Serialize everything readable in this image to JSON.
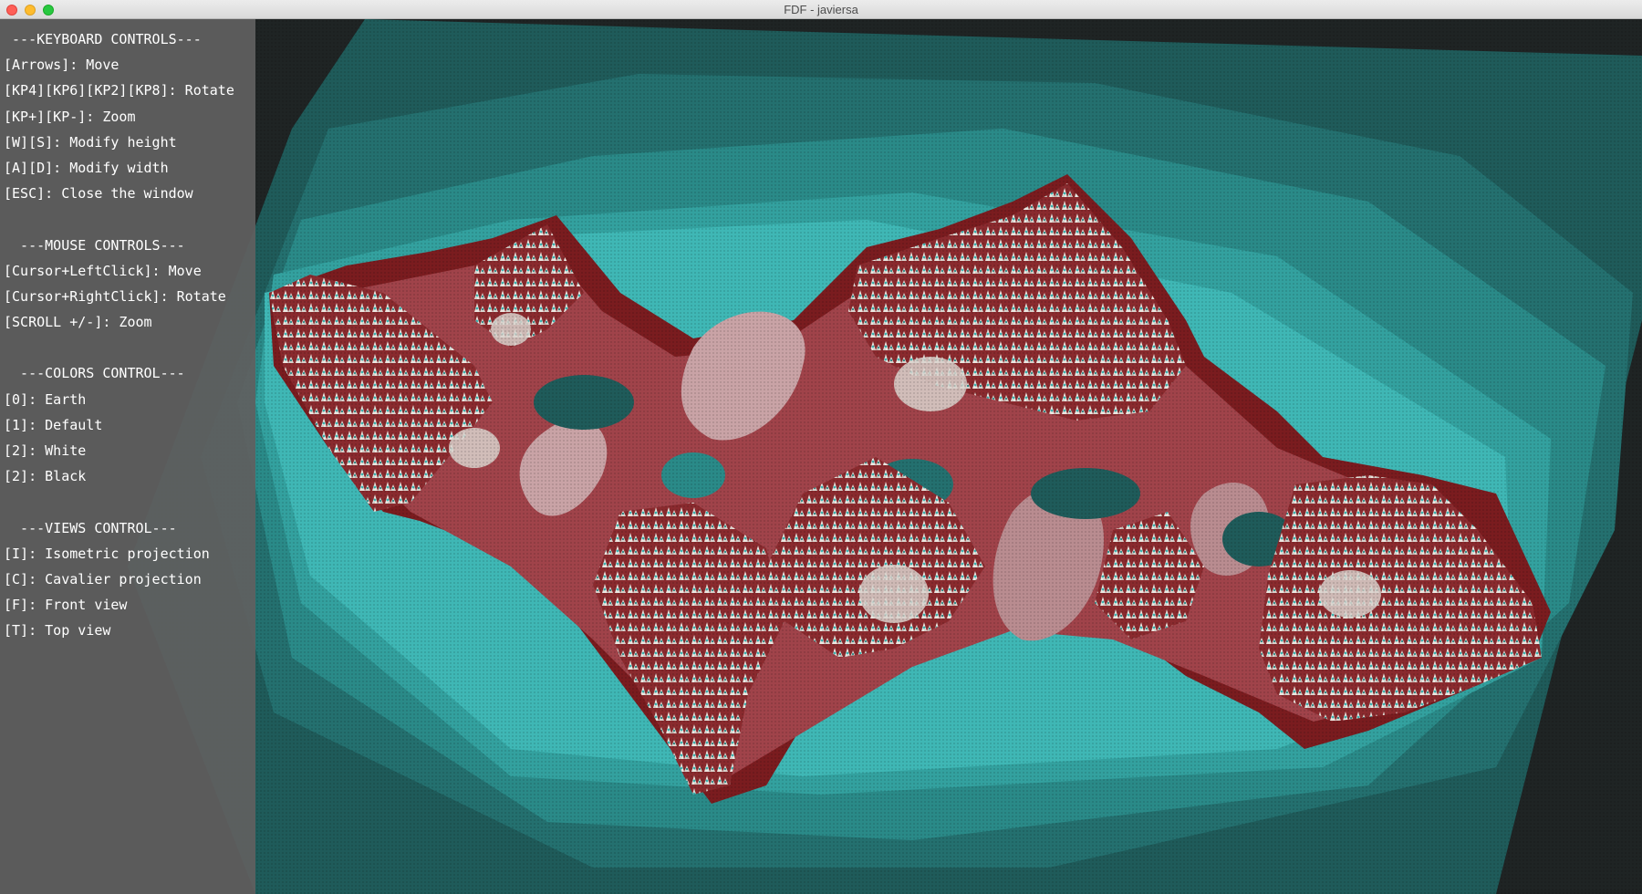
{
  "window": {
    "title": "FDF - javiersa"
  },
  "controls": {
    "keyboard": {
      "header": " ---KEYBOARD CONTROLS---",
      "items": [
        "[Arrows]: Move",
        "[KP4][KP6][KP2][KP8]: Rotate",
        "[KP+][KP-]: Zoom",
        "[W][S]: Modify height",
        "[A][D]: Modify width",
        "[ESC]: Close the window"
      ]
    },
    "mouse": {
      "header": "  ---MOUSE CONTROLS---",
      "items": [
        "[Cursor+LeftClick]: Move",
        "[Cursor+RightClick]: Rotate",
        "[SCROLL +/-]: Zoom"
      ]
    },
    "colors": {
      "header": "  ---COLORS CONTROL---",
      "items": [
        "[0]: Earth",
        "[1]: Default",
        "[2]: White",
        "[2]: Black"
      ]
    },
    "views": {
      "header": "  ---VIEWS CONTROL---",
      "items": [
        "[I]: Isometric projection",
        "[C]: Cavalier projection",
        "[F]: Front view",
        "[T]: Top view"
      ]
    }
  },
  "render": {
    "palette": {
      "background": "#1f2424",
      "teal_dark": "#1f5b5a",
      "teal_mid": "#2a8a88",
      "teal_light": "#3fb7b5",
      "red_dark": "#7a1c1f",
      "red_mid": "#a0434a",
      "pink": "#c9a3a6",
      "peak": "#e8e4df"
    }
  }
}
